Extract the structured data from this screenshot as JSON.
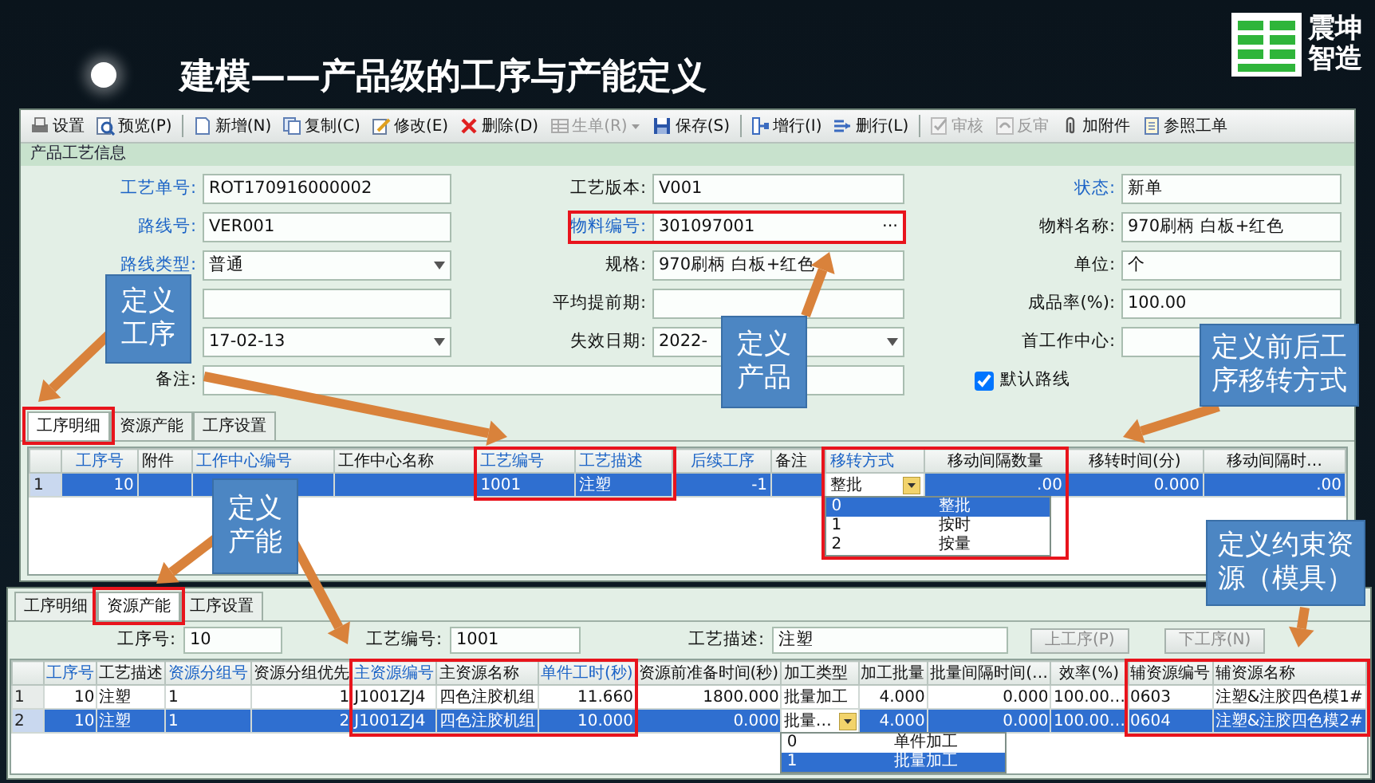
{
  "slide": {
    "title": "建模——产品级的工序与产能定义",
    "logo_text": [
      "震坤",
      "智造"
    ]
  },
  "toolbar": [
    {
      "kind": "button",
      "label": "设置",
      "disabled": false,
      "dropdown": false
    },
    {
      "kind": "button",
      "label": "预览(P)",
      "disabled": false,
      "dropdown": false
    },
    {
      "kind": "separator"
    },
    {
      "kind": "button",
      "label": "新增(N)",
      "disabled": false,
      "dropdown": false
    },
    {
      "kind": "button",
      "label": "复制(C)",
      "disabled": false,
      "dropdown": false
    },
    {
      "kind": "button",
      "label": "修改(E)",
      "disabled": false,
      "dropdown": false
    },
    {
      "kind": "button",
      "label": "删除(D)",
      "disabled": false,
      "dropdown": false
    },
    {
      "kind": "button",
      "label": "生单(R)",
      "disabled": true,
      "dropdown": true
    },
    {
      "kind": "button",
      "label": "保存(S)",
      "disabled": false,
      "dropdown": false
    },
    {
      "kind": "separator"
    },
    {
      "kind": "button",
      "label": "增行(I)",
      "disabled": false,
      "dropdown": false
    },
    {
      "kind": "button",
      "label": "删行(L)",
      "disabled": false,
      "dropdown": false
    },
    {
      "kind": "separator"
    },
    {
      "kind": "button",
      "label": "审核",
      "disabled": true,
      "dropdown": false
    },
    {
      "kind": "button",
      "label": "反审",
      "disabled": true,
      "dropdown": false
    },
    {
      "kind": "button",
      "label": "加附件",
      "disabled": false,
      "dropdown": false
    },
    {
      "kind": "button",
      "label": "参照工单",
      "disabled": false,
      "dropdown": false
    }
  ],
  "form": {
    "title": "产品工艺信息",
    "rows": [
      [
        {
          "label": "工艺单号:",
          "highlighted": true,
          "kind": "text",
          "value": "ROT170916000002",
          "outlined": false
        },
        {
          "label": "工艺版本:",
          "highlighted": false,
          "kind": "text",
          "value": "V001",
          "outlined": false
        },
        {
          "label": "状态:",
          "highlighted": true,
          "kind": "text",
          "value": "新单",
          "outlined": false
        }
      ],
      [
        {
          "label": "路线号:",
          "highlighted": true,
          "kind": "text",
          "value": "VER001",
          "outlined": false
        },
        {
          "label": "物料编号:",
          "highlighted": true,
          "kind": "lookup",
          "value": "301097001",
          "lookup_button": "···",
          "outlined": true
        },
        {
          "label": "物料名称:",
          "highlighted": false,
          "kind": "text",
          "value": "970刷柄 白板+红色",
          "outlined": false
        }
      ],
      [
        {
          "label": "路线类型:",
          "highlighted": true,
          "kind": "select",
          "value": "普通",
          "outlined": false
        },
        {
          "label": "规格:",
          "highlighted": false,
          "kind": "text",
          "value": "970刷柄 白板+红色",
          "outlined": false
        },
        {
          "label": "单位:",
          "highlighted": false,
          "kind": "text",
          "value": "个",
          "outlined": false
        }
      ],
      [
        {
          "kind": "text",
          "outlined": false
        },
        {
          "label": "平均提前期:",
          "highlighted": false,
          "kind": "text",
          "outlined": false
        },
        {
          "label": "成品率(%):",
          "highlighted": false,
          "kind": "text",
          "value": "100.00",
          "outlined": false
        }
      ],
      [
        {
          "kind": "select",
          "value": "17-02-13",
          "outlined": false
        },
        {
          "label": "失效日期:",
          "highlighted": false,
          "kind": "select",
          "value": "2022-",
          "outlined": false
        },
        {
          "label": "首工作中心:",
          "highlighted": false,
          "kind": "text",
          "outlined": false
        }
      ],
      [
        {
          "label": "备注:",
          "highlighted": false,
          "kind": "memo",
          "outlined": false
        },
        {
          "kind": "checkbox",
          "label": "默认路线",
          "checked": true,
          "outlined": false
        }
      ]
    ]
  },
  "tabs": [
    {
      "label": "工序明细",
      "selected": true,
      "outlined": true
    },
    {
      "label": "资源产能",
      "selected": false,
      "outlined": false
    },
    {
      "label": "工序设置",
      "selected": false,
      "outlined": false
    }
  ],
  "grid": {
    "columns": [
      {
        "label": "工序号",
        "highlighted": true,
        "numeric": true,
        "outlined": false
      },
      {
        "label": "附件",
        "highlighted": false,
        "numeric": false,
        "outlined": false
      },
      {
        "label": "工作中心编号",
        "highlighted": true,
        "numeric": false,
        "outlined": false
      },
      {
        "label": "工作中心名称",
        "highlighted": false,
        "numeric": false,
        "outlined": false
      },
      {
        "label": "工艺编号",
        "highlighted": true,
        "numeric": false,
        "outlined": true
      },
      {
        "label": "工艺描述",
        "highlighted": true,
        "numeric": false,
        "outlined": true
      },
      {
        "label": "后续工序",
        "highlighted": true,
        "numeric": true,
        "outlined": false
      },
      {
        "label": "备注",
        "highlighted": false,
        "numeric": false,
        "outlined": false
      },
      {
        "label": "移转方式",
        "highlighted": true,
        "numeric": false,
        "outlined": true
      },
      {
        "label": "移动间隔数量",
        "highlighted": false,
        "numeric": true,
        "outlined": true
      },
      {
        "label": "移转时间(分)",
        "highlighted": false,
        "numeric": true,
        "outlined": false
      },
      {
        "label": "移动间隔时…",
        "highlighted": false,
        "numeric": true,
        "outlined": false
      }
    ],
    "rows": [
      {
        "row_header": "1",
        "selected": true,
        "cells": [
          "10",
          null,
          null,
          null,
          "1001",
          "注塑",
          "-1",
          null,
          {
            "value": "整批",
            "options": [
              {
                "code": "0",
                "name": "整批",
                "selected": true
              },
              {
                "code": "1",
                "name": "按时",
                "selected": false
              },
              {
                "code": "2",
                "name": "按量",
                "selected": false
              }
            ]
          },
          ".00",
          "0.000",
          ".00"
        ]
      }
    ]
  },
  "bottom": {
    "tabs": [
      {
        "label": "工序明细",
        "selected": false,
        "outlined": false
      },
      {
        "label": "资源产能",
        "selected": true,
        "outlined": true
      },
      {
        "label": "工序设置",
        "selected": false,
        "outlined": false
      }
    ],
    "fields": [
      {
        "label": "工序号:",
        "value": "10"
      },
      {
        "label": "工艺编号:",
        "value": "1001"
      },
      {
        "label": "工艺描述:",
        "value": "注塑"
      }
    ],
    "buttons": [
      {
        "label": "上工序(P)",
        "disabled": true
      },
      {
        "label": "下工序(N)",
        "disabled": true
      }
    ],
    "grid": {
      "columns": [
        {
          "label": "工序号",
          "highlighted": true,
          "numeric": true,
          "outlined": false
        },
        {
          "label": "工艺描述",
          "highlighted": false,
          "numeric": false,
          "outlined": false
        },
        {
          "label": "资源分组号",
          "highlighted": true,
          "numeric": false,
          "outlined": false
        },
        {
          "label": "资源分组优先",
          "highlighted": false,
          "numeric": true,
          "outlined": false
        },
        {
          "label": "主资源编号",
          "highlighted": true,
          "numeric": false,
          "outlined": true
        },
        {
          "label": "主资源名称",
          "highlighted": false,
          "numeric": false,
          "outlined": true
        },
        {
          "label": "单件工时(秒)",
          "highlighted": true,
          "numeric": true,
          "outlined": true
        },
        {
          "label": "资源前准备时间(秒)",
          "highlighted": false,
          "numeric": true,
          "outlined": false
        },
        {
          "label": "加工类型",
          "highlighted": false,
          "numeric": false,
          "outlined": false
        },
        {
          "label": "加工批量",
          "highlighted": false,
          "numeric": true,
          "outlined": false
        },
        {
          "label": "批量间隔时间(…",
          "highlighted": false,
          "numeric": true,
          "outlined": false
        },
        {
          "label": "效率(%)",
          "highlighted": false,
          "numeric": true,
          "outlined": false
        },
        {
          "label": "辅资源编号",
          "highlighted": false,
          "numeric": false,
          "outlined": true
        },
        {
          "label": "辅资源名称",
          "highlighted": false,
          "numeric": false,
          "outlined": true
        }
      ],
      "rows": [
        {
          "row_header": "1",
          "selected": false,
          "cells": [
            "10",
            "注塑",
            "1",
            "1",
            "J1001ZJ4",
            "四色注胶机组",
            "11.660",
            "1800.000",
            "批量加工",
            "4.000",
            "0.000",
            "100.00…",
            "0603",
            "注塑&注胶四色模1#"
          ]
        },
        {
          "row_header": "2",
          "selected": true,
          "cells": [
            "10",
            "注塑",
            "1",
            "2",
            "J1001ZJ4",
            "四色注胶机组",
            "10.000",
            "0.000",
            {
              "value": "批量…",
              "options": [
                {
                  "code": "0",
                  "name": "单件加工",
                  "selected": false
                },
                {
                  "code": "1",
                  "name": "批量加工",
                  "selected": true
                }
              ]
            },
            "4.000",
            "0.000",
            "100.00…",
            "0604",
            "注塑&注胶四色模2#"
          ]
        }
      ]
    }
  },
  "callouts": [
    {
      "text": "定义工序"
    },
    {
      "text": "定义产品"
    },
    {
      "text": "定义前后工序移转方式"
    },
    {
      "text": "定义产能"
    },
    {
      "text": "定义约束资源（模具）"
    }
  ]
}
